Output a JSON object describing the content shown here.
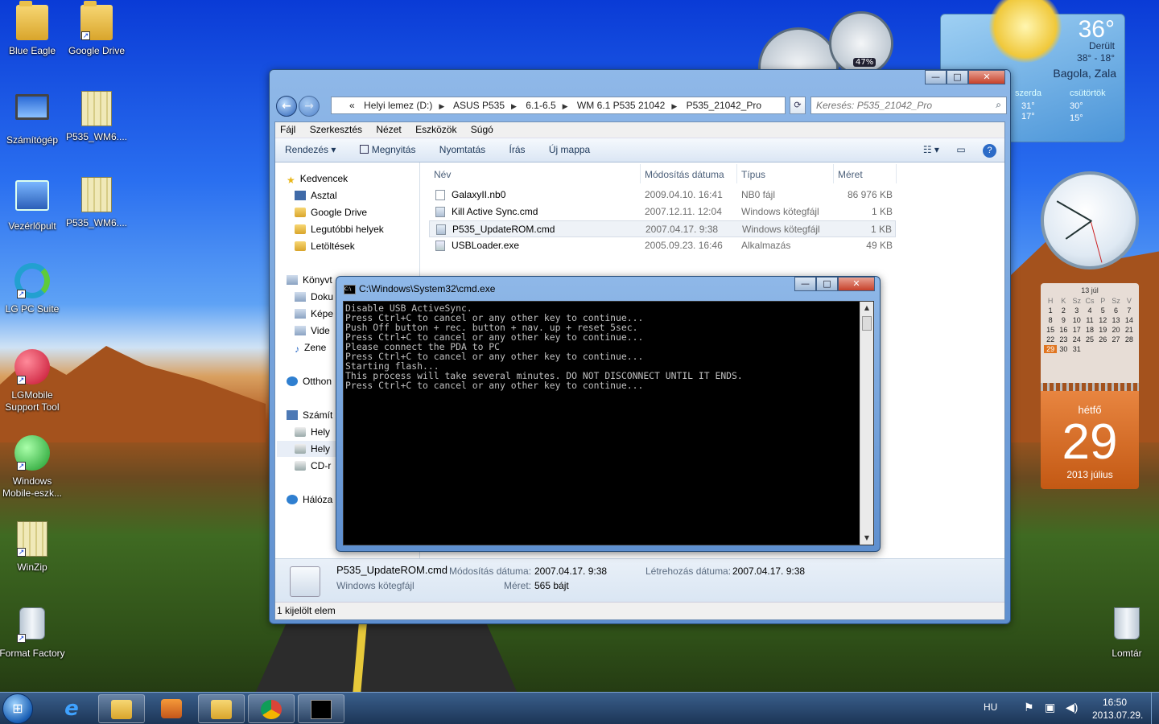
{
  "desktop": {
    "icons": [
      {
        "label": "Blue Eagle"
      },
      {
        "label": "Google Drive"
      },
      {
        "label": "Számítógép"
      },
      {
        "label": "P535_WM6...."
      },
      {
        "label": "Vezérlőpult"
      },
      {
        "label": "P535_WM6...."
      },
      {
        "label": "LG PC Suite"
      },
      {
        "label": "LGMobile Support Tool"
      },
      {
        "label": "Windows Mobile-eszk..."
      },
      {
        "label": "WinZip"
      },
      {
        "label": "Format Factory"
      },
      {
        "label": "Lomtár"
      }
    ]
  },
  "gadgets": {
    "weather": {
      "temp": "36°",
      "desc": "Derült",
      "range": "38° - 18°",
      "location": "Bagola, Zala",
      "day1": "szerda",
      "day1_temps": "31°\n17°",
      "day2": "csütörtök",
      "day2_hi": "30°",
      "day2_lo": "15°"
    },
    "meter": {
      "value": "47%"
    },
    "calendar": {
      "month_header": "13 júl",
      "weekdays": [
        "H",
        "K",
        "Sz",
        "Cs",
        "P",
        "Sz",
        "V"
      ],
      "days": [
        "1",
        "2",
        "3",
        "4",
        "5",
        "6",
        "7",
        "8",
        "9",
        "10",
        "11",
        "12",
        "13",
        "14",
        "15",
        "16",
        "17",
        "18",
        "19",
        "20",
        "21",
        "22",
        "23",
        "24",
        "25",
        "26",
        "27",
        "28",
        "29",
        "30",
        "31"
      ],
      "selected": "29",
      "day_name": "hétfő",
      "day_number": "29",
      "month_year": "2013 július"
    }
  },
  "explorer": {
    "window_buttons": {
      "minimize": "—",
      "maximize": "□",
      "close": "✕"
    },
    "address": {
      "prefix": "«",
      "crumbs": [
        "Helyi lemez (D:)",
        "ASUS P535",
        "6.1-6.5",
        "WM 6.1 P535 21042",
        "P535_21042_Pro"
      ]
    },
    "search_placeholder": "Keresés: P535_21042_Pro",
    "menu": [
      "Fájl",
      "Szerkesztés",
      "Nézet",
      "Eszközök",
      "Súgó"
    ],
    "toolbar": {
      "organize": "Rendezés ▾",
      "open": "Megnyitás",
      "print": "Nyomtatás",
      "burn": "Írás",
      "new_folder": "Új mappa",
      "help": "?"
    },
    "nav": {
      "favorites": "Kedvencek",
      "desktop": "Asztal",
      "gdrive": "Google Drive",
      "recent": "Legutóbbi helyek",
      "downloads": "Letöltések",
      "libraries": "Könyvt",
      "docs": "Doku",
      "pics": "Képe",
      "videos": "Vide",
      "music": "Zene",
      "homegroup": "Otthon",
      "computer": "Számít",
      "drive_c": "Hely",
      "drive_d": "Hely",
      "cd": "CD-r",
      "network": "Hálóza"
    },
    "columns": {
      "name": "Név",
      "date": "Módosítás dátuma",
      "type": "Típus",
      "size": "Méret"
    },
    "files": [
      {
        "name": "GalaxyII.nb0",
        "date": "2009.04.10. 16:41",
        "type": "NB0 fájl",
        "size": "86 976 KB"
      },
      {
        "name": "Kill Active Sync.cmd",
        "date": "2007.12.11. 12:04",
        "type": "Windows kötegfájl",
        "size": "1 KB"
      },
      {
        "name": "P535_UpdateROM.cmd",
        "date": "2007.04.17. 9:38",
        "type": "Windows kötegfájl",
        "size": "1 KB"
      },
      {
        "name": "USBLoader.exe",
        "date": "2005.09.23. 16:46",
        "type": "Alkalmazás",
        "size": "49 KB"
      }
    ],
    "details": {
      "filename": "P535_UpdateROM.cmd",
      "filetype": "Windows kötegfájl",
      "mod_label": "Módosítás dátuma:",
      "mod_value": "2007.04.17. 9:38",
      "size_label": "Méret:",
      "size_value": "565 bájt",
      "created_label": "Létrehozás dátuma:",
      "created_value": "2007.04.17. 9:38"
    },
    "status": "1 kijelölt elem"
  },
  "cmd": {
    "title": "C:\\Windows\\System32\\cmd.exe",
    "output": "Disable USB ActiveSync.\nPress Ctrl+C to cancel or any other key to continue...\nPush Off button + rec. button + nav. up + reset 5sec.\nPress Ctrl+C to cancel or any other key to continue...\nPlease connect the PDA to PC\nPress Ctrl+C to cancel or any other key to continue...\nStarting flash...\nThis process will take several minutes. DO NOT DISCONNECT UNTIL IT ENDS.\nPress Ctrl+C to cancel or any other key to continue..."
  },
  "taskbar": {
    "lang": "HU",
    "time": "16:50",
    "date": "2013.07.29."
  }
}
